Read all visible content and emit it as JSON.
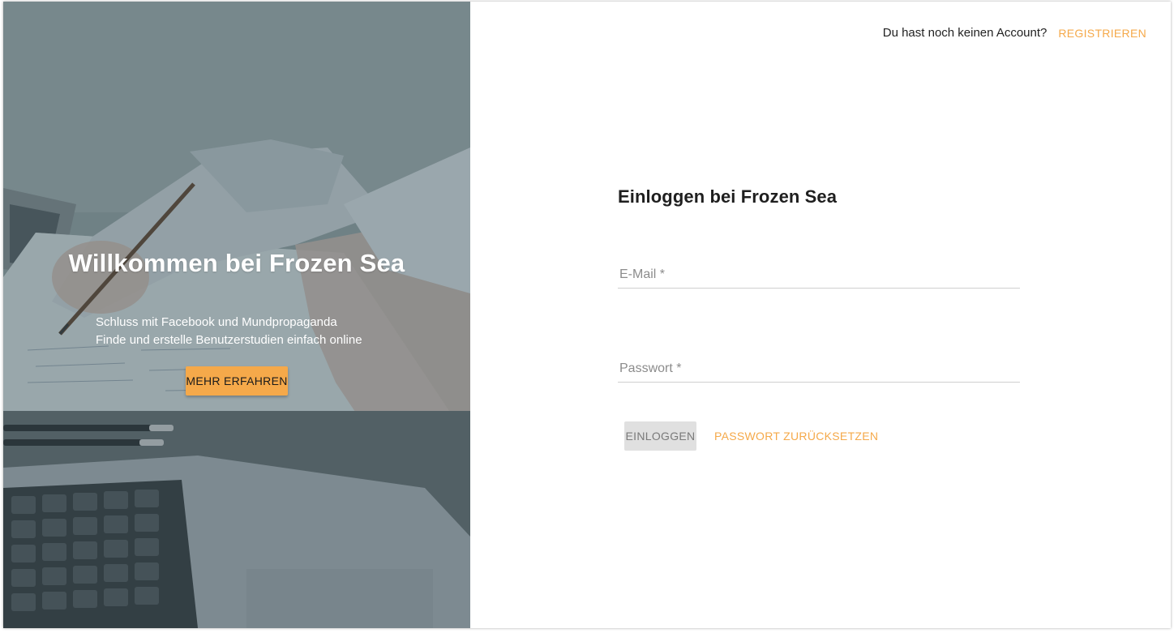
{
  "hero": {
    "title": "Willkommen bei Frozen Sea",
    "subtitle_line1": "Schluss mit Facebook und Mundpropaganda",
    "subtitle_line2": "Finde und erstelle Benutzerstudien einfach online",
    "cta_label": "MEHR ERFAHREN"
  },
  "topbar": {
    "question": "Du hast noch keinen Account?",
    "register_label": "REGISTRIEREN"
  },
  "login": {
    "title": "Einloggen bei Frozen Sea",
    "email_label": "E-Mail *",
    "password_label": "Passwort *",
    "submit_label": "EINLOGGEN",
    "reset_label": "PASSWORT ZURÜCKSETZEN"
  },
  "colors": {
    "accent": "#f5a94a",
    "disabled_button_bg": "#e0e0e0",
    "disabled_button_text": "#7a7a7a",
    "hero_overlay": "#3e5660"
  }
}
